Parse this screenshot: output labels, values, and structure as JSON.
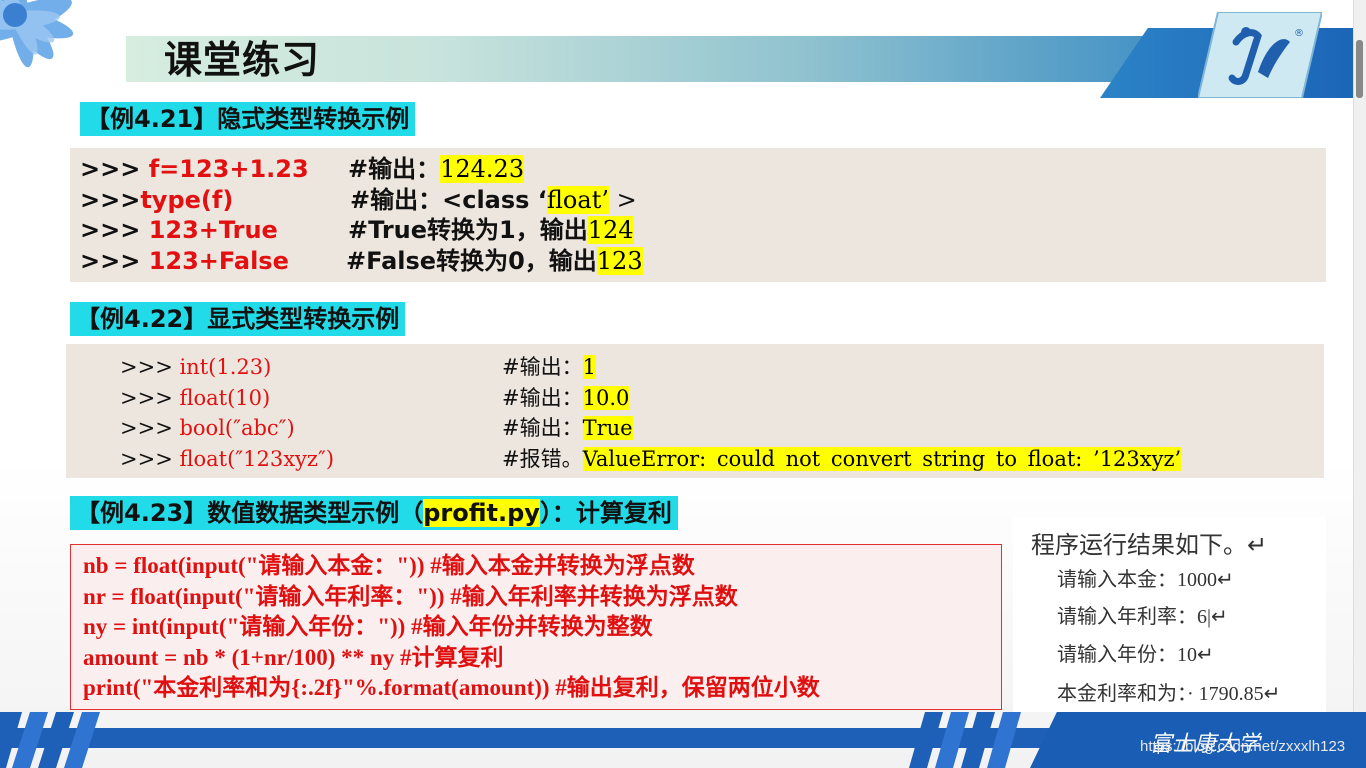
{
  "slide": {
    "title": "课堂练习",
    "footer_text": "富士康大学",
    "watermark": "https://blog.csdn.net/zxxxlh123"
  },
  "colors": {
    "heading_bg": "#22dbe8",
    "highlight": "#ffff00",
    "code_red": "#e21010",
    "footer_blue": "#1e5fb8"
  },
  "example1": {
    "title": "【例4.21】隐式类型转换示例",
    "lines": [
      {
        "prompt": ">>> ",
        "code": "f=123+1.23",
        "comment": "#输出：",
        "result": "124.23",
        "suffix": ""
      },
      {
        "prompt": ">>>",
        "code": "type(f)",
        "comment": "#输出：<class ‘",
        "result": "float’",
        "suffix": " >"
      },
      {
        "prompt": ">>> ",
        "code": "123+True",
        "comment": "#True转换为1，输出",
        "result": "124",
        "suffix": ""
      },
      {
        "prompt": ">>> ",
        "code": "123+False",
        "comment": "#False转换为0，输出",
        "result": "123",
        "suffix": ""
      }
    ]
  },
  "example2": {
    "title": "【例4.22】显式类型转换示例",
    "lines": [
      {
        "prompt": ">>> ",
        "code": "int(1.23)",
        "comment": "#输出：",
        "result": "1"
      },
      {
        "prompt": ">>> ",
        "code": "float(10)",
        "comment": "#输出：",
        "result": "10.0"
      },
      {
        "prompt": ">>> ",
        "code": "bool(″abc″)",
        "comment": "#输出：",
        "result": "True"
      },
      {
        "prompt": ">>> ",
        "code": "float(″123xyz″)",
        "comment": "#报错。",
        "result": "ValueError: could not convert string to float: ’123xyz’"
      }
    ]
  },
  "example3": {
    "title_prefix": "【例4.23】数值数据类型示例（",
    "title_file": "profit.py",
    "title_suffix": "）：计算复利",
    "lines": [
      "nb = float(input(\"请输入本金：\"))    #输入本金并转换为浮点数",
      "nr = float(input(\"请输入年利率：\"))  #输入年利率并转换为浮点数",
      "ny = int(input(\"请输入年份：\"))     #输入年份并转换为整数",
      "amount = nb * (1+nr/100) ** ny     #计算复利",
      "print(\"本金利率和为{:.2f}\"%.format(amount))  #输出复利，保留两位小数"
    ]
  },
  "output_panel": {
    "heading": "程序运行结果如下。↵",
    "lines": [
      "请输入本金：1000↵",
      "请输入年利率：6|↵",
      "请输入年份：10↵",
      "本金利率和为：· 1790.85↵"
    ]
  }
}
